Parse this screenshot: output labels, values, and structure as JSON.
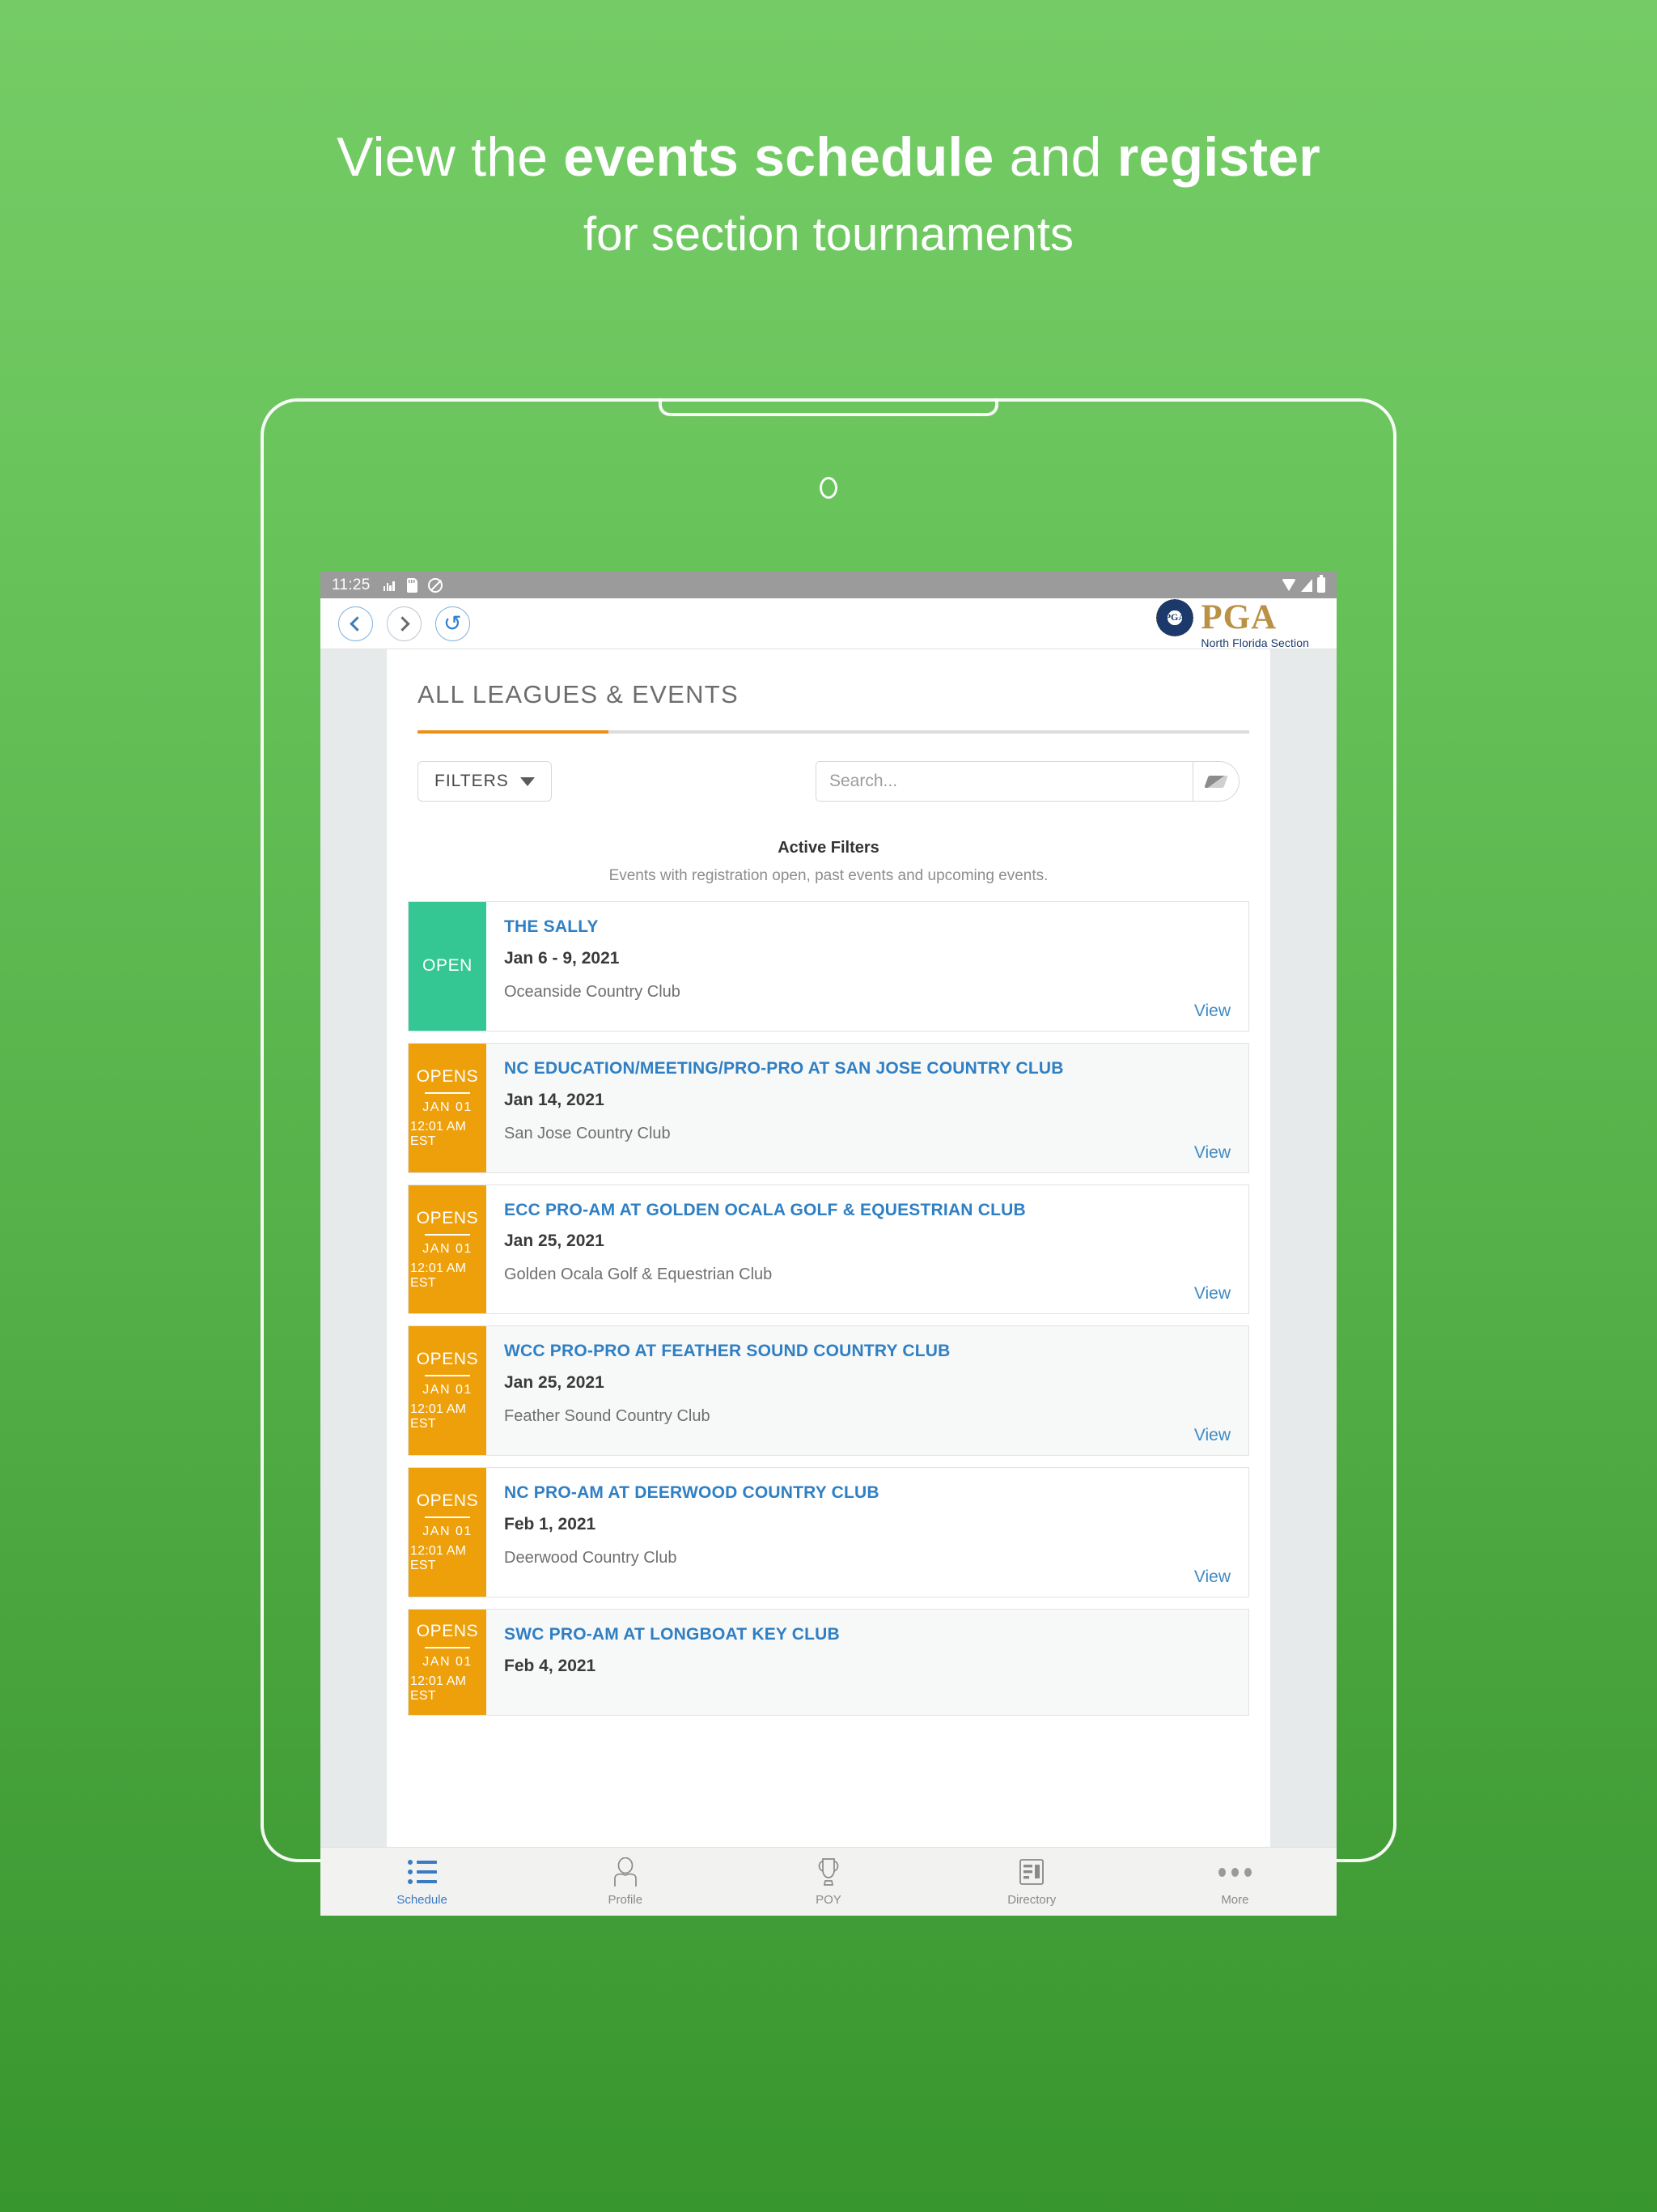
{
  "promo": {
    "line1_plain_a": "View the ",
    "line1_bold_a": "events schedule",
    "line1_plain_b": " and ",
    "line1_bold_b": "register",
    "line2": "for section tournaments"
  },
  "statusbar": {
    "time": "11:25",
    "icons": [
      "network-activity-icon",
      "sd-card-icon",
      "no-alarm-icon",
      "wifi-icon",
      "signal-icon",
      "battery-icon"
    ]
  },
  "appheader": {
    "back_label": "Back",
    "forward_label": "Forward",
    "refresh_label": "Refresh",
    "logo_seal_text": "PGA",
    "logo_word": "PGA",
    "logo_subtitle": "North Florida Section"
  },
  "page": {
    "title": "ALL LEAGUES & EVENTS",
    "accent_color": "#ef9013"
  },
  "toolbar": {
    "filters_label": "FILTERS",
    "search_placeholder": "Search...",
    "search_value": "",
    "erase_label": "Clear"
  },
  "active_filters": {
    "heading": "Active Filters",
    "description": "Events with registration open, past events and upcoming events."
  },
  "cards": [
    {
      "status": "OPEN",
      "status_kind": "open",
      "opens_date": "",
      "opens_time": "",
      "title": "THE SALLY",
      "date": "Jan 6 - 9, 2021",
      "venue": "Oceanside Country Club",
      "view_label": "View"
    },
    {
      "status": "OPENS",
      "status_kind": "opens",
      "opens_date": "JAN  01",
      "opens_time": "12:01 AM EST",
      "title": "NC EDUCATION/MEETING/PRO-PRO AT SAN JOSE COUNTRY CLUB",
      "date": "Jan 14, 2021",
      "venue": "San Jose Country Club",
      "view_label": "View"
    },
    {
      "status": "OPENS",
      "status_kind": "opens",
      "opens_date": "JAN  01",
      "opens_time": "12:01 AM EST",
      "title": "ECC PRO-AM AT GOLDEN OCALA GOLF & EQUESTRIAN CLUB",
      "date": "Jan 25, 2021",
      "venue": "Golden Ocala Golf & Equestrian Club",
      "view_label": "View"
    },
    {
      "status": "OPENS",
      "status_kind": "opens",
      "opens_date": "JAN  01",
      "opens_time": "12:01 AM EST",
      "title": "WCC PRO-PRO AT FEATHER SOUND COUNTRY CLUB",
      "date": "Jan 25, 2021",
      "venue": "Feather Sound Country Club",
      "view_label": "View"
    },
    {
      "status": "OPENS",
      "status_kind": "opens",
      "opens_date": "JAN  01",
      "opens_time": "12:01 AM EST",
      "title": "NC PRO-AM AT DEERWOOD COUNTRY CLUB",
      "date": "Feb 1, 2021",
      "venue": "Deerwood Country Club",
      "view_label": "View"
    },
    {
      "status": "OPENS",
      "status_kind": "opens",
      "opens_date": "JAN  01",
      "opens_time": "12:01 AM EST",
      "title": "SWC PRO-AM AT LONGBOAT KEY CLUB",
      "date": "Feb 4, 2021",
      "venue": "",
      "view_label": ""
    }
  ],
  "tabbar": [
    {
      "label": "Schedule",
      "icon": "list-icon",
      "active": true
    },
    {
      "label": "Profile",
      "icon": "person-icon",
      "active": false
    },
    {
      "label": "POY",
      "icon": "trophy-icon",
      "active": false
    },
    {
      "label": "Directory",
      "icon": "id-card-icon",
      "active": false
    },
    {
      "label": "More",
      "icon": "ellipsis-icon",
      "active": false
    }
  ]
}
